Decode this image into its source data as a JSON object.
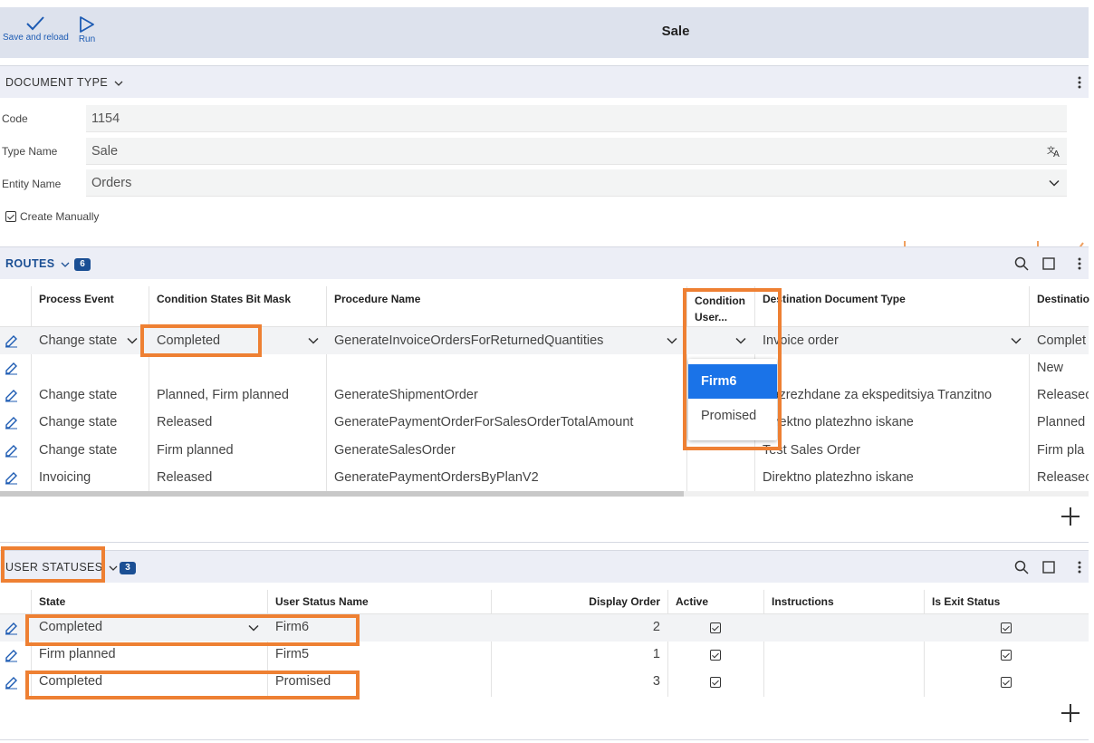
{
  "toolbar": {
    "save_label": "Save and reload",
    "run_label": "Run",
    "title": "Sale"
  },
  "document_type": {
    "header": "DOCUMENT TYPE",
    "fields": {
      "code_label": "Code",
      "code_value": "1154",
      "type_name_label": "Type Name",
      "type_name_value": "Sale",
      "entity_name_label": "Entity Name",
      "entity_name_value": "Orders",
      "create_manually_label": "Create Manually",
      "create_manually_checked": true
    }
  },
  "routes": {
    "header": "ROUTES",
    "count": "6",
    "columns": [
      "Process Event",
      "Condition States Bit Mask",
      "Procedure Name",
      "Condition User...",
      "Destination Document Type",
      "Destinatio"
    ],
    "condition_user_header_line1": "Condition",
    "condition_user_header_line2": "User...",
    "rows": [
      {
        "event": "Change state",
        "mask": "Completed",
        "procedure": "GenerateInvoiceOrdersForReturnedQuantities",
        "dest_type": "Invoice order",
        "dest": "Complet"
      },
      {
        "event": "",
        "mask": "",
        "procedure": "",
        "dest_type": "",
        "dest": "New"
      },
      {
        "event": "Change state",
        "mask": "Planned, Firm planned",
        "procedure": "GenerateShipmentOrder",
        "dest_type": "Razrezhdane za ekspeditsiya Tranzitno",
        "dest": "Releasec"
      },
      {
        "event": "Change state",
        "mask": "Released",
        "procedure": "GeneratePaymentOrderForSalesOrderTotalAmount",
        "dest_type": "Direktno platezhno iskane",
        "dest": "Planned"
      },
      {
        "event": "Change state",
        "mask": "Firm planned",
        "procedure": "GenerateSalesOrder",
        "dest_type": "Test Sales Order",
        "dest": "Firm pla"
      },
      {
        "event": "Invoicing",
        "mask": "Released",
        "procedure": "GeneratePaymentOrdersByPlanV2",
        "dest_type": "Direktno platezhno iskane",
        "dest": "Releasec"
      }
    ],
    "dropdown_options": [
      "Firm6",
      "Promised"
    ],
    "dropdown_selected": "Firm6"
  },
  "user_statuses": {
    "header": "USER STATUSES",
    "count": "3",
    "columns": [
      "State",
      "User Status Name",
      "Display Order",
      "Active",
      "Instructions",
      "Is Exit Status"
    ],
    "rows": [
      {
        "state": "Completed",
        "name": "Firm6",
        "order": "2",
        "active": true,
        "instructions": "",
        "exit": true
      },
      {
        "state": "Firm planned",
        "name": "Firm5",
        "order": "1",
        "active": true,
        "instructions": "",
        "exit": true
      },
      {
        "state": "Completed",
        "name": "Promised",
        "order": "3",
        "active": true,
        "instructions": "",
        "exit": true
      }
    ]
  },
  "colors": {
    "accent": "#1b4f94",
    "highlight": "#ee8033",
    "dropdown_selected_bg": "#1a73e8",
    "toolbar_bg": "#dde2ed"
  },
  "icons": [
    "check-icon",
    "play-icon",
    "chevron-down-icon",
    "kebab-menu-icon",
    "translate-icon",
    "search-icon",
    "square-icon",
    "edit-icon",
    "plus-icon"
  ]
}
